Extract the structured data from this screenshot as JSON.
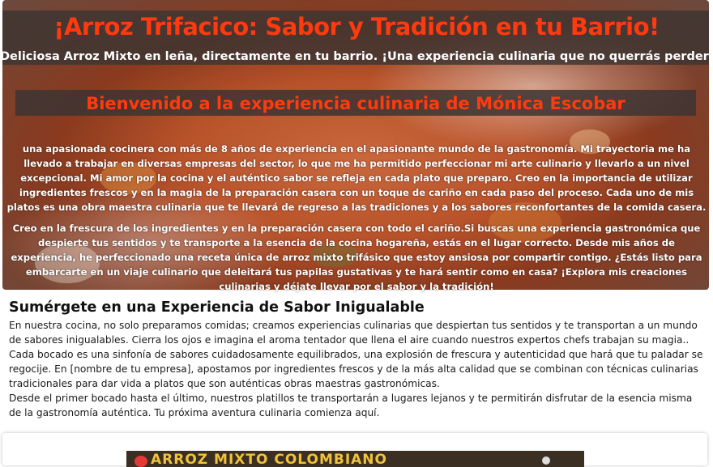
{
  "hero": {
    "title": "¡Arroz Trifacico: Sabor y Tradición en tu Barrio!",
    "subtitle": "Deliciosa Arroz Mixto en leña, directamente en tu barrio. ¡Una experiencia culinaria que no querrás perderte!",
    "welcome": "Bienvenido a la experiencia culinaria de Mónica Escobar",
    "paragraph1": "una apasionada cocinera con más de 8 años de experiencia en el apasionante mundo de la gastronomía. Mi trayectoria me ha llevado a trabajar en diversas empresas del sector, lo que me ha permitido perfeccionar mi arte culinario y llevarlo a un nivel excepcional. Mi amor por la cocina y el auténtico sabor se refleja en cada plato que preparo. Creo en la importancia de utilizar ingredientes frescos y en la magia de la preparación casera con un toque de cariño en cada paso del proceso. Cada uno de mis platos es una obra maestra culinaria que te llevará de regreso a las tradiciones y a los sabores reconfortantes de la comida casera.",
    "paragraph2": "Creo en la frescura de los ingredientes y en la preparación casera con todo el cariño.Si buscas una experiencia gastronómica que despierte tus sentidos y te transporte a la esencia de la cocina hogareña, estás en el lugar correcto. Desde mis años de experiencia, he perfeccionado una receta única de arroz mixto trifásico que estoy ansiosa por compartir contigo. ¿Estás listo para embarcarte en un viaje culinario que deleitará tus papilas gustativas y te hará sentir como en casa? ¡Explora mis creaciones culinarias y déjate llevar por el sabor y la tradición!"
  },
  "section": {
    "title": "Sumérgete en una Experiencia de Sabor Inigualable",
    "lines": [
      "En nuestra cocina, no solo preparamos comidas; creamos experiencias culinarias que despiertan tus sentidos y te transportan a un mundo de sabores inigualables. Cierra los ojos e imagina el aroma tentador que llena el aire cuando nuestros expertos chefs trabajan su magia..",
      "Cada bocado es una sinfonía de sabores cuidadosamente equilibrados, una explosión de frescura y autenticidad que hará que tu paladar se regocije. En [nombre de tu empresa], apostamos por ingredientes frescos y de la más alta calidad que se combinan con técnicas culinarias tradicionales para dar vida a platos que son auténticas obras maestras gastronómicas.",
      "Desde el primer bocado hasta el último, nuestros platillos te transportarán a lugares lejanos y te permitirán disfrutar de la esencia misma de la gastronomía auténtica. Tu próxima aventura culinaria comienza aquí."
    ]
  },
  "video": {
    "title": "ARROZ MIXTO COLOMBIANO"
  },
  "colors": {
    "accent": "#ff3a0e",
    "overlay": "#3c3432"
  }
}
